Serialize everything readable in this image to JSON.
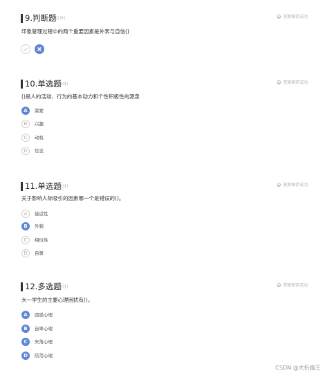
{
  "questions": [
    {
      "number": "9.判断题",
      "score": "(2分)",
      "save_status": "答案保存成功",
      "stem": "印象管理过程中的两个重要因素是外表与自信()",
      "answer_true_icon": "check-icon",
      "answer_false_icon": "cross-icon",
      "selected": "false"
    },
    {
      "number": "10.单选题",
      "score": "(1分)",
      "save_status": "答案保存成功",
      "stem": "()是人的活动、行为的基本动力和个性积极性的源泉",
      "options": [
        {
          "letter": "A",
          "text": "需要",
          "selected": true
        },
        {
          "letter": "B",
          "text": "兴趣",
          "selected": false
        },
        {
          "letter": "C",
          "text": "动机",
          "selected": false
        },
        {
          "letter": "D",
          "text": "信念",
          "selected": false
        }
      ]
    },
    {
      "number": "11.单选题",
      "score": "(1分)",
      "save_status": "答案保存成功",
      "stem": "关于影响人际吸引的因素哪一个是错误的()。",
      "options": [
        {
          "letter": "A",
          "text": "接近性",
          "selected": false
        },
        {
          "letter": "B",
          "text": "外貌",
          "selected": true
        },
        {
          "letter": "C",
          "text": "相似性",
          "selected": false
        },
        {
          "letter": "D",
          "text": "自尊",
          "selected": false
        }
      ]
    },
    {
      "number": "12.多选题",
      "score": "(2分)",
      "save_status": "答案保存成功",
      "stem": "大一学生的主要心理困扰有()。",
      "options": [
        {
          "letter": "A",
          "text": "困惑心理",
          "selected": true
        },
        {
          "letter": "B",
          "text": "自卑心理",
          "selected": true
        },
        {
          "letter": "C",
          "text": "失落心理",
          "selected": true
        },
        {
          "letter": "D",
          "text": "防范心理",
          "selected": true
        }
      ]
    }
  ],
  "watermark": "CSDN @大折扇王",
  "colors": {
    "accent": "#5f86d4",
    "muted": "#b5b5b5",
    "text": "#333333"
  }
}
